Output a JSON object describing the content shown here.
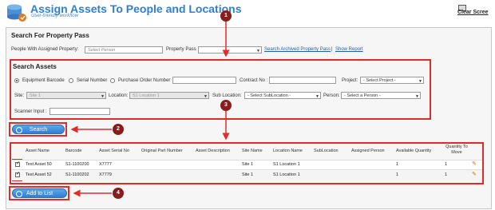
{
  "header": {
    "title": "Assign Assets To People and Locations",
    "subtitle": "User-friendly workflow",
    "clear_label": "Clear Scree"
  },
  "property_pass": {
    "section_title": "Search For Property Pass",
    "people_label": "People With Assigned Property:",
    "people_placeholder": "Select Person",
    "property_pass_label": "Property Pass",
    "search_archived_link": "Search Archived Property Pass",
    "separator": "|",
    "show_report_link": "Show Report"
  },
  "search_assets": {
    "section_title": "Search Assets",
    "radios": [
      {
        "label": "Equipment Barcode",
        "checked": true
      },
      {
        "label": "Serial Number",
        "checked": false
      },
      {
        "label": "Purchase Order Number",
        "checked": false
      }
    ],
    "contract_label": "Contract No :",
    "project_label": "Project:",
    "project_value": "- Select Project -",
    "site_label": "Site:",
    "site_value": "Site 1",
    "location_label": "Location:",
    "location_value": "S1 Location 1",
    "sublocation_label": "Sub Location:",
    "sublocation_value": "- Select SubLocation -",
    "person_label": "Person:",
    "person_value": "- Select a Person -",
    "scanner_label": "Scanner Input :"
  },
  "buttons": {
    "search_label": "Search",
    "add_label": "Add to List"
  },
  "callouts": [
    "1",
    "2",
    "3",
    "4"
  ],
  "table": {
    "columns": [
      "Asset Name",
      "Barcode",
      "Asset Serial No",
      "Original Part Number",
      "Asset Description",
      "Site Name",
      "Location Name",
      "SubLocation",
      "Assigned Person",
      "Available Quantity",
      "Quantity To Move"
    ],
    "rows": [
      {
        "checked": true,
        "asset_name": "Test Asset 50",
        "barcode": "S1-1100200",
        "serial": "X7777",
        "site": "Site 1",
        "location": "S1 Location 1",
        "available": "1",
        "move": "1"
      },
      {
        "checked": true,
        "asset_name": "Test Asset 52",
        "barcode": "S1-1100202",
        "serial": "X7779",
        "site": "Site 1",
        "location": "S1 Location 1",
        "available": "1",
        "move": "1"
      }
    ]
  },
  "colors": {
    "accent": "#2f7fd1",
    "highlight": "#e02b2b",
    "callout": "#8b1c1c"
  }
}
